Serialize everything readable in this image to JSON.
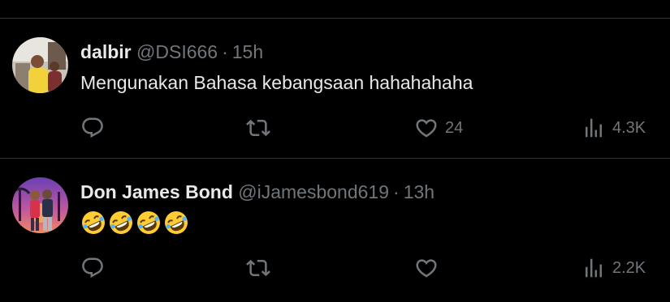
{
  "tweets": [
    {
      "display_name": "dalbir",
      "handle": "@DSI666",
      "separator": "·",
      "time": "15h",
      "text": "Mengunakan Bahasa kebangsaan hahahahaha",
      "reply_count": "",
      "retweet_count": "",
      "like_count": "24",
      "view_count": "4.3K"
    },
    {
      "display_name": "Don James Bond",
      "handle": "@iJamesbond619",
      "separator": "·",
      "time": "13h",
      "emojis": [
        "rofl-emoji",
        "rofl-emoji",
        "rofl-emoji",
        "rofl-emoji"
      ],
      "reply_count": "",
      "retweet_count": "",
      "like_count": "",
      "view_count": "2.2K"
    }
  ],
  "icons": {
    "reply": "reply-icon",
    "retweet": "retweet-icon",
    "like": "heart-icon",
    "views": "views-bar-icon"
  },
  "colors": {
    "background": "#000000",
    "primary_text": "#e7e9ea",
    "secondary_text": "#71767b",
    "divider": "#2f3336",
    "emoji_face": "#ffcc33"
  }
}
